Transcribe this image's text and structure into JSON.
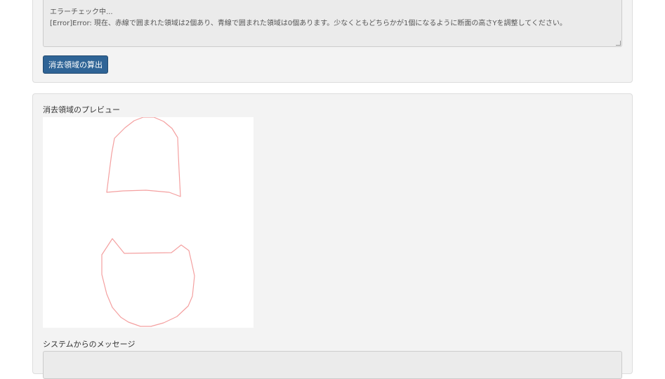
{
  "log": {
    "lines": [
      "エラーチェック中...",
      "[Error]Error: 現在、赤線で囲まれた領域は2個あり、青線で囲まれた領域は0個あります。少なくともどちらかが1個になるように断面の高さYを調整してください。"
    ]
  },
  "actions": {
    "compute_label": "消去領域の算出"
  },
  "preview": {
    "label": "消去領域のプレビュー",
    "stroke_color": "#f4a0a0",
    "region_count": 2
  },
  "messages": {
    "label": "システムからのメッセージ",
    "value": ""
  },
  "colors": {
    "primary_button": "#2f6496",
    "panel_bg": "#f3f3f3",
    "textarea_bg": "#ebebeb"
  }
}
